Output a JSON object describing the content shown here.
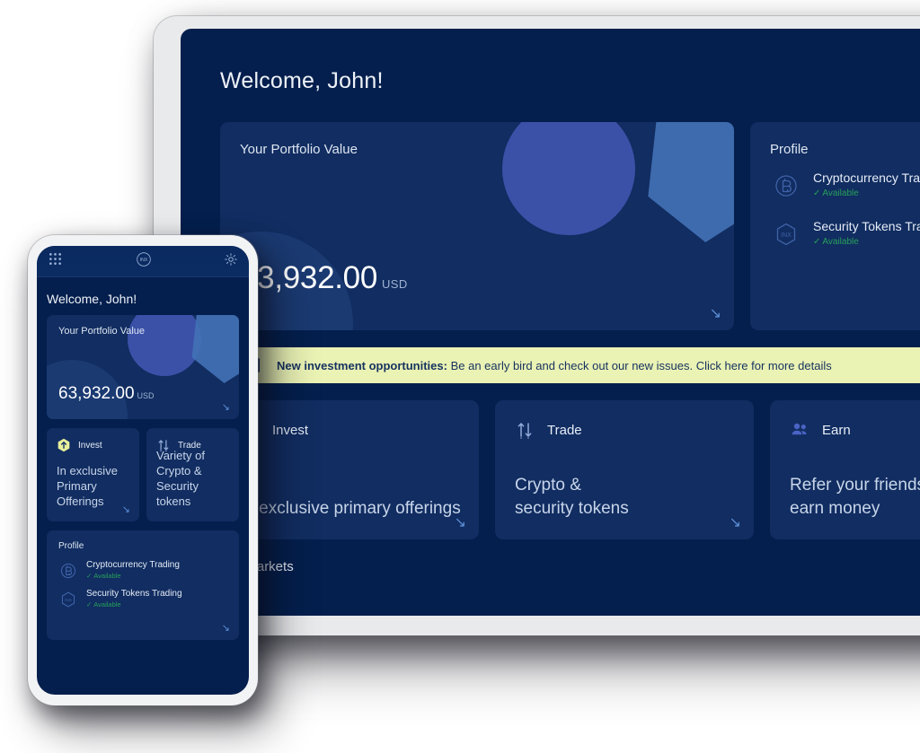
{
  "desktop": {
    "welcome": "Welcome, John!",
    "portfolio": {
      "label": "Your Portfolio Value",
      "amount": "63,932.00",
      "currency": "USD",
      "expand_icon": "arrow-down-right-icon"
    },
    "profile": {
      "title": "Profile",
      "items": [
        {
          "icon": "bitcoin-icon",
          "name": "Cryptocurrency Trading",
          "status": "Available"
        },
        {
          "icon": "inx-hexagon-icon",
          "name": "Security Tokens Trading",
          "status": "Available"
        }
      ]
    },
    "banner": {
      "icon": "inx-badge-icon",
      "bold": "New investment opportunities:",
      "rest": " Be an early bird and check out our new issues. Click here for more details"
    },
    "tiles": [
      {
        "icon": "invest-hexagon-arrow-icon",
        "title": "Invest",
        "desc": "In exclusive primary offerings"
      },
      {
        "icon": "trade-arrows-icon",
        "title": "Trade",
        "desc": "Crypto &\nsecurity tokens"
      },
      {
        "icon": "earn-people-icon",
        "title": "Earn",
        "desc": "Refer your friends &\nearn money"
      }
    ],
    "section_title": "Top Markets"
  },
  "phone": {
    "topbar": {
      "menu_icon": "grid-menu-icon",
      "logo": "INX",
      "brightness_icon": "sun-icon"
    },
    "welcome": "Welcome, John!",
    "portfolio": {
      "label": "Your Portfolio Value",
      "amount": "63,932.00",
      "currency": "USD"
    },
    "tiles": [
      {
        "icon": "invest-hexagon-arrow-icon",
        "title": "Invest",
        "desc": "In exclusive Primary Offerings"
      },
      {
        "icon": "trade-arrows-icon",
        "title": "Trade",
        "desc": "Variety of Crypto & Security tokens"
      }
    ],
    "profile": {
      "title": "Profile",
      "items": [
        {
          "icon": "bitcoin-icon",
          "name": "Cryptocurrency Trading",
          "status": "Available"
        },
        {
          "icon": "inx-hexagon-icon",
          "name": "Security Tokens Trading",
          "status": "Available"
        }
      ]
    }
  },
  "colors": {
    "page_bg": "#041f4d",
    "card_bg": "#112d61",
    "accent_purple": "#3b51a8",
    "accent_blue": "#4271b5",
    "banner_bg": "#eaf2b4",
    "banner_text": "#16325f",
    "status_green": "#28a05a",
    "invest_yellow": "#e8ef9a",
    "arrow_blue": "#5d8ed8"
  }
}
